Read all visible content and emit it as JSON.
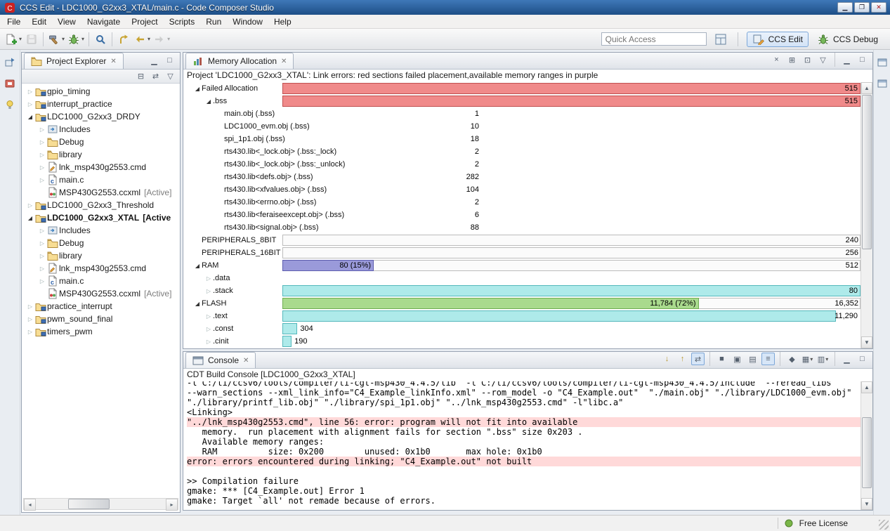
{
  "window": {
    "title": "CCS Edit - LDC1000_G2xx3_XTAL/main.c - Code Composer Studio"
  },
  "menus": [
    "File",
    "Edit",
    "View",
    "Navigate",
    "Project",
    "Scripts",
    "Run",
    "Window",
    "Help"
  ],
  "toolbar": {
    "quick_access_placeholder": "Quick Access",
    "buttons": [
      {
        "name": "new",
        "icon": "new",
        "dropdown": true
      },
      {
        "name": "save",
        "icon": "save",
        "disabled": true
      },
      {
        "sep": true
      },
      {
        "name": "build",
        "icon": "build",
        "dropdown": true
      },
      {
        "name": "debug",
        "icon": "debug",
        "dropdown": true
      },
      {
        "sep": true
      },
      {
        "name": "search",
        "icon": "search"
      },
      {
        "sep": true
      },
      {
        "name": "last-edit-location",
        "icon": "last-edit"
      },
      {
        "name": "back",
        "icon": "back",
        "dropdown": true
      },
      {
        "name": "forward",
        "icon": "forward",
        "dropdown": true,
        "disabled": true
      }
    ],
    "perspectives": [
      {
        "label": "CCS Edit",
        "active": true,
        "icon": "ccs-edit"
      },
      {
        "label": "CCS Debug",
        "active": false,
        "icon": "debug"
      }
    ]
  },
  "explorer": {
    "title": "Project Explorer",
    "toolbar": [
      "collapse-all",
      "link-with-editor",
      "view-menu"
    ],
    "items": [
      {
        "label": "gpio_timing",
        "icon": "project",
        "level": 0,
        "arrow": "collapsed"
      },
      {
        "label": "interrupt_practice",
        "icon": "project",
        "level": 0,
        "arrow": "collapsed"
      },
      {
        "label": "LDC1000_G2xx3_DRDY",
        "icon": "project",
        "level": 0,
        "arrow": "expanded"
      },
      {
        "label": "Includes",
        "icon": "includes",
        "level": 1,
        "arrow": "collapsed"
      },
      {
        "label": "Debug",
        "icon": "folder",
        "level": 1,
        "arrow": "collapsed"
      },
      {
        "label": "library",
        "icon": "folder",
        "level": 1,
        "arrow": "collapsed"
      },
      {
        "label": "lnk_msp430g2553.cmd",
        "icon": "file-cmd",
        "level": 1,
        "arrow": "collapsed"
      },
      {
        "label": "main.c",
        "icon": "file-c",
        "level": 1,
        "arrow": "collapsed"
      },
      {
        "label": "MSP430G2553.ccxml",
        "suffix": "[Active]",
        "icon": "file-ccxml",
        "level": 1
      },
      {
        "label": "LDC1000_G2xx3_Threshold",
        "icon": "project",
        "level": 0,
        "arrow": "collapsed"
      },
      {
        "label": "LDC1000_G2xx3_XTAL",
        "suffix": "[Active",
        "bold": true,
        "icon": "project",
        "level": 0,
        "arrow": "expanded"
      },
      {
        "label": "Includes",
        "icon": "includes",
        "level": 1,
        "arrow": "collapsed"
      },
      {
        "label": "Debug",
        "icon": "folder",
        "level": 1,
        "arrow": "collapsed"
      },
      {
        "label": "library",
        "icon": "folder",
        "level": 1,
        "arrow": "collapsed"
      },
      {
        "label": "lnk_msp430g2553.cmd",
        "icon": "file-cmd",
        "level": 1,
        "arrow": "collapsed"
      },
      {
        "label": "main.c",
        "icon": "file-c",
        "level": 1,
        "arrow": "collapsed"
      },
      {
        "label": "MSP430G2553.ccxml",
        "suffix": "[Active]",
        "icon": "file-ccxml",
        "level": 1
      },
      {
        "label": "practice_interrupt",
        "icon": "project",
        "level": 0,
        "arrow": "collapsed"
      },
      {
        "label": "pwm_sound_final",
        "icon": "project",
        "level": 0,
        "arrow": "collapsed"
      },
      {
        "label": "timers_pwm",
        "icon": "project",
        "level": 0,
        "arrow": "collapsed"
      }
    ]
  },
  "memory": {
    "title": "Memory Allocation",
    "info": "Project 'LDC1000_G2xx3_XTAL': Link errors: red sections failed placement,available memory ranges in purple",
    "toolbar": [
      "clear",
      "new-view",
      "pin-view",
      "view-menu",
      "|",
      "minimize",
      "maximize"
    ],
    "rows": [
      {
        "label": "Failed Allocation",
        "level": 0,
        "arrow": "expanded",
        "track": true,
        "fill": {
          "color": "failed",
          "pct": 100,
          "label": "515"
        }
      },
      {
        "label": ".bss",
        "level": 1,
        "arrow": "expanded",
        "track": true,
        "fill": {
          "color": "failed",
          "pct": 100,
          "label": "515"
        }
      },
      {
        "label": "main.obj (.bss)",
        "level": 2,
        "value": "1"
      },
      {
        "label": "LDC1000_evm.obj (.bss)",
        "level": 2,
        "value": "10"
      },
      {
        "label": "spi_1p1.obj (.bss)",
        "level": 2,
        "value": "18"
      },
      {
        "label": "rts430.lib<_lock.obj> (.bss:_lock)",
        "level": 2,
        "value": "2"
      },
      {
        "label": "rts430.lib<_lock.obj> (.bss:_unlock)",
        "level": 2,
        "value": "2"
      },
      {
        "label": "rts430.lib<defs.obj> (.bss)",
        "level": 2,
        "value": "282"
      },
      {
        "label": "rts430.lib<xfvalues.obj> (.bss)",
        "level": 2,
        "value": "104"
      },
      {
        "label": "rts430.lib<errno.obj> (.bss)",
        "level": 2,
        "value": "2"
      },
      {
        "label": "rts430.lib<feraiseexcept.obj> (.bss)",
        "level": 2,
        "value": "6"
      },
      {
        "label": "rts430.lib<signal.obj> (.bss)",
        "level": 2,
        "value": "88"
      },
      {
        "label": "PERIPHERALS_8BIT",
        "level": 0,
        "track": true,
        "total": "240"
      },
      {
        "label": "PERIPHERALS_16BIT",
        "level": 0,
        "track": true,
        "total": "256"
      },
      {
        "label": "RAM",
        "level": 0,
        "arrow": "expanded",
        "track": true,
        "total": "512",
        "fill": {
          "color": "ram",
          "pct": 15.8,
          "label": "80 (15%)"
        }
      },
      {
        "label": ".data",
        "level": 1,
        "arrow": "collapsed"
      },
      {
        "label": ".stack",
        "level": 1,
        "arrow": "collapsed",
        "fill": {
          "color": "section",
          "pct": 100,
          "label": "80"
        }
      },
      {
        "label": "FLASH",
        "level": 0,
        "arrow": "expanded",
        "track": true,
        "total": "16,352",
        "fill": {
          "color": "flash",
          "pct": 72,
          "label": "11,784 (72%)"
        }
      },
      {
        "label": ".text",
        "level": 1,
        "arrow": "collapsed",
        "fill": {
          "color": "section",
          "pct": 95.8,
          "label": "11,290"
        }
      },
      {
        "label": ".const",
        "level": 1,
        "arrow": "collapsed",
        "fill": {
          "color": "section",
          "pct": 2.6,
          "label": "304",
          "labelPos": "after"
        }
      },
      {
        "label": ".cinit",
        "level": 1,
        "arrow": "collapsed",
        "fill": {
          "color": "section",
          "pct": 1.6,
          "label": "190",
          "labelPos": "after"
        }
      }
    ]
  },
  "console": {
    "title": "Console",
    "subtitle": "CDT Build Console [LDC1000_G2xx3_XTAL]",
    "toolbar": [
      "next-error",
      "previous-error",
      "show-console-on-output",
      "|",
      "terminate",
      "remove-launch",
      "clear-console",
      "scroll-lock",
      "|",
      "pin-console",
      "open-console",
      "display-selected",
      "|",
      "minimize",
      "maximize"
    ],
    "lines": [
      {
        "text": "-l C:/ti/ccsv6/tools/compiler/ti-cgt-msp430_4.4.5/lib  -l C:/ti/ccsv6/tools/compiler/ti-cgt-msp430_4.4.5/include  --reread_libs",
        "error": false
      },
      {
        "text": "--warn_sections --xml_link_info=\"C4_Example_linkInfo.xml\" --rom_model -o \"C4_Example.out\"  \"./main.obj\" \"./library/LDC1000_evm.obj\"",
        "error": false
      },
      {
        "text": "\"./library/printf_lib.obj\" \"./library/spi_1p1.obj\" \"../lnk_msp430g2553.cmd\" -l\"libc.a\"",
        "error": false
      },
      {
        "text": "<Linking>",
        "error": false
      },
      {
        "text": "\"../lnk_msp430g2553.cmd\", line 56: error: program will not fit into available",
        "error": true
      },
      {
        "text": "   memory.  run placement with alignment fails for section \".bss\" size 0x203 .",
        "error": false
      },
      {
        "text": "   Available memory ranges:",
        "error": false
      },
      {
        "text": "   RAM          size: 0x200        unused: 0x1b0       max hole: 0x1b0",
        "error": false
      },
      {
        "text": "error: errors encountered during linking; \"C4_Example.out\" not built",
        "error": true
      },
      {
        "text": "",
        "error": false
      },
      {
        "text": ">> Compilation failure",
        "error": false
      },
      {
        "text": "gmake: *** [C4_Example.out] Error 1",
        "error": false
      },
      {
        "text": "gmake: Target `all' not remade because of errors.",
        "error": false
      }
    ]
  },
  "statusbar": {
    "license": "Free License"
  },
  "colors": {
    "failed": "#f08a8a",
    "failed_border": "#c05050",
    "ram": "#9a9ada",
    "ram_border": "#5c5cae",
    "flash": "#a9da8d",
    "flash_border": "#6fae52",
    "section": "#aeeaea",
    "section_border": "#55b8bc",
    "error_bg": "#ffd9d9"
  }
}
